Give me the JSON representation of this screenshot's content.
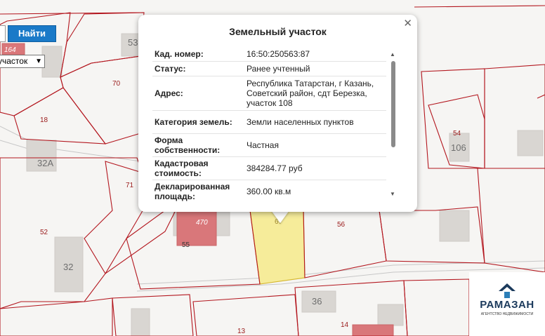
{
  "search": {
    "button_label": "Найти",
    "type_selected": "участок"
  },
  "map_labels": {
    "b164": "164",
    "b53": "53",
    "b32a": "32А",
    "b32": "32",
    "b470": "470",
    "b55": "55",
    "b106": "106",
    "b36": "36",
    "p70": "70",
    "p18": "18",
    "p71": "71",
    "p52": "52",
    "p54": "54",
    "p56": "56",
    "p67": "67",
    "p13": "13",
    "p14": "14"
  },
  "popup": {
    "title": "Земельный участок",
    "close_icon": "close-icon",
    "rows": [
      {
        "key": "Кад. номер:",
        "value": "16:50:250563:87"
      },
      {
        "key": "Статус:",
        "value": "Ранее учтенный"
      },
      {
        "key": "Адрес:",
        "value": "Республика Татарстан, г Казань, Советский район, сдт Березка, участок 108"
      },
      {
        "key": "Категория земель:",
        "value": "Земли населенных пунктов"
      },
      {
        "key": "Форма собственности:",
        "value": "Частная"
      },
      {
        "key": "Кадастровая стоимость:",
        "value": "384284.77 руб"
      },
      {
        "key": "Декларированная площадь:",
        "value": "360.00 кв.м"
      }
    ]
  },
  "logo": {
    "name": "РАМАЗАН",
    "tagline": "АГЕНТСТВО НЕДВИЖИМОСТИ"
  },
  "colors": {
    "plot_border": "#b3161e",
    "selected_plot": "#f6ec9a",
    "button": "#1a7ac8"
  }
}
